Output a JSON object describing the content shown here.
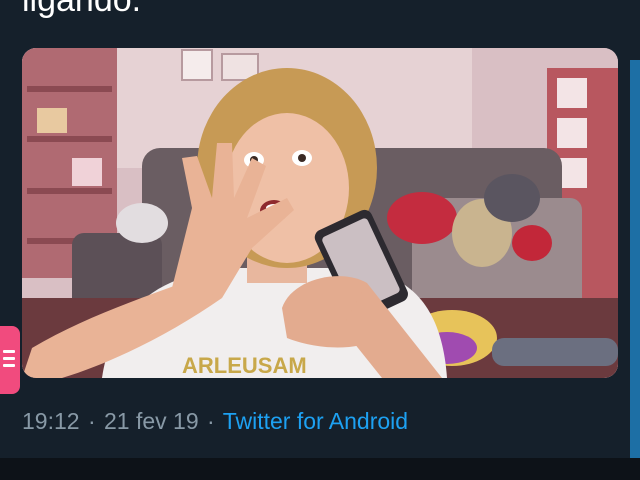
{
  "tweet": {
    "text": "ligando.",
    "time": "19:12",
    "separator": "·",
    "date": "21 fev 19",
    "source": "Twitter for Android"
  },
  "media": {
    "type": "photo",
    "description_icon": "photo-thumbnail"
  },
  "side_button": {
    "icon": "menu-icon",
    "color": "#f14b7e"
  },
  "colors": {
    "background": "#15202b",
    "meta_text": "#8899a6",
    "link": "#1da1f2"
  }
}
